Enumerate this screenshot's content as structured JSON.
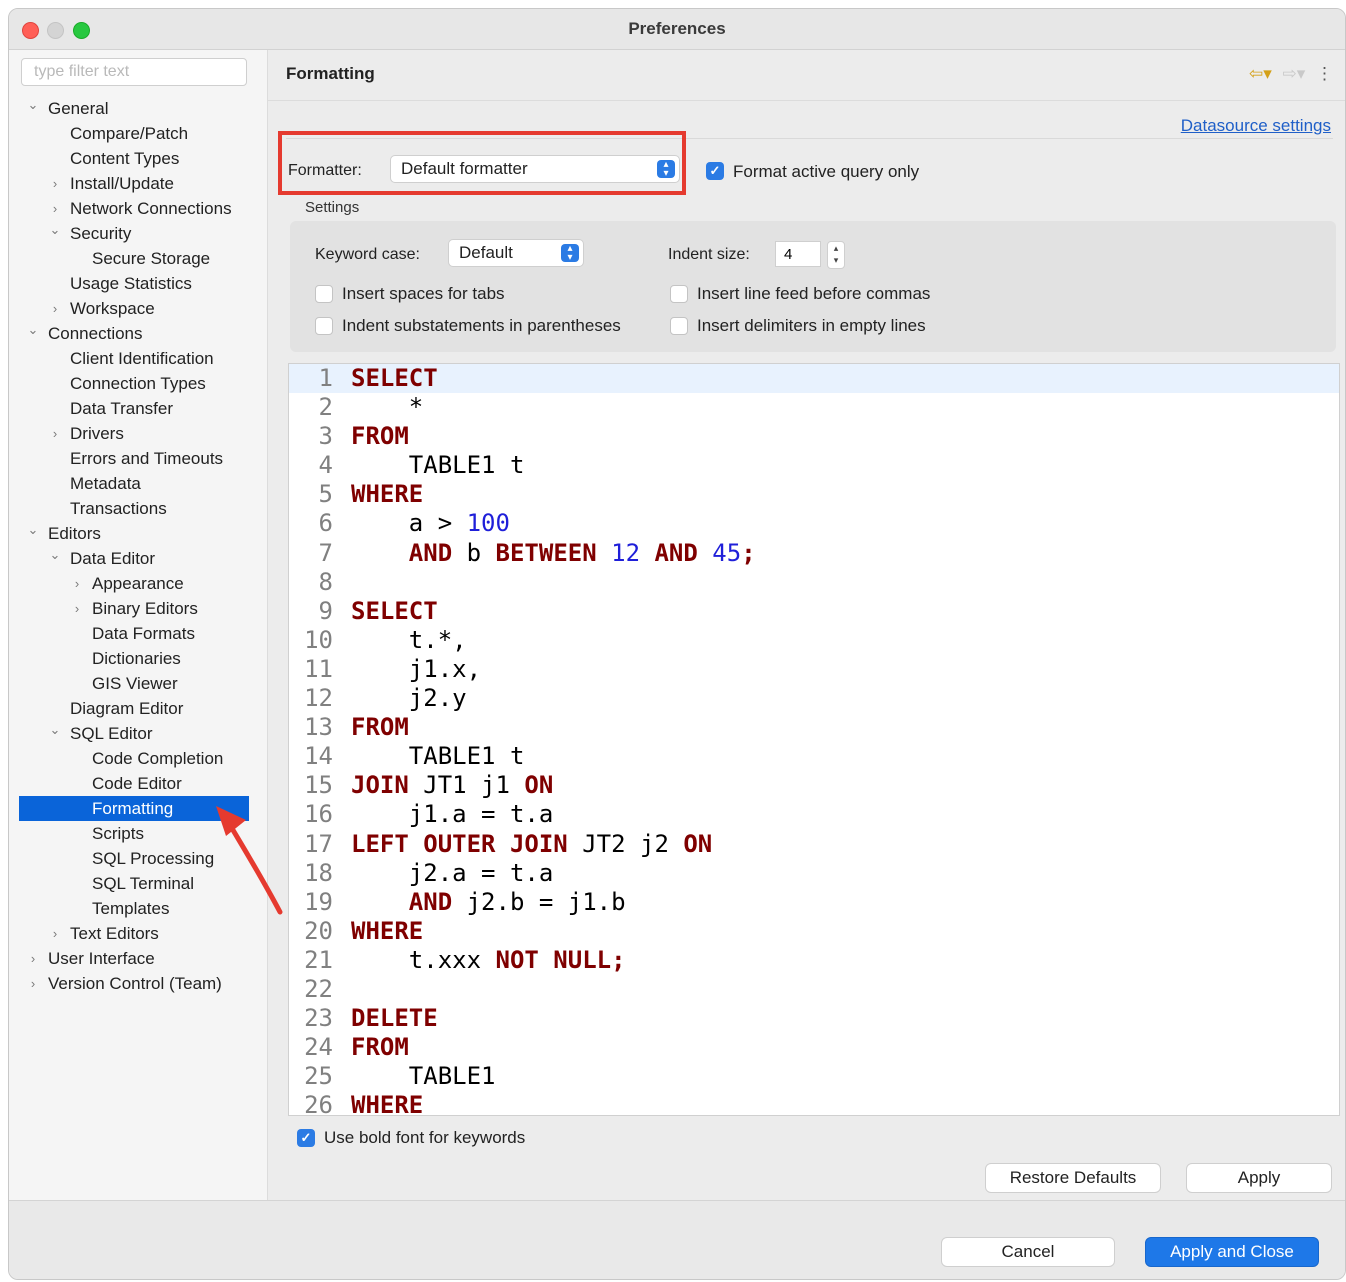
{
  "window": {
    "title": "Preferences"
  },
  "sidebar": {
    "filter_placeholder": "type filter text",
    "items": [
      {
        "label": "General",
        "indent": 0,
        "chev": "v"
      },
      {
        "label": "Compare/Patch",
        "indent": 1,
        "chev": ""
      },
      {
        "label": "Content Types",
        "indent": 1,
        "chev": ""
      },
      {
        "label": "Install/Update",
        "indent": 1,
        "chev": ">"
      },
      {
        "label": "Network Connections",
        "indent": 1,
        "chev": ">"
      },
      {
        "label": "Security",
        "indent": 1,
        "chev": "v"
      },
      {
        "label": "Secure Storage",
        "indent": 2,
        "chev": ""
      },
      {
        "label": "Usage Statistics",
        "indent": 1,
        "chev": ""
      },
      {
        "label": "Workspace",
        "indent": 1,
        "chev": ">"
      },
      {
        "label": "Connections",
        "indent": 0,
        "chev": "v"
      },
      {
        "label": "Client Identification",
        "indent": 1,
        "chev": ""
      },
      {
        "label": "Connection Types",
        "indent": 1,
        "chev": ""
      },
      {
        "label": "Data Transfer",
        "indent": 1,
        "chev": ""
      },
      {
        "label": "Drivers",
        "indent": 1,
        "chev": ">"
      },
      {
        "label": "Errors and Timeouts",
        "indent": 1,
        "chev": ""
      },
      {
        "label": "Metadata",
        "indent": 1,
        "chev": ""
      },
      {
        "label": "Transactions",
        "indent": 1,
        "chev": ""
      },
      {
        "label": "Editors",
        "indent": 0,
        "chev": "v"
      },
      {
        "label": "Data Editor",
        "indent": 1,
        "chev": "v"
      },
      {
        "label": "Appearance",
        "indent": 2,
        "chev": ">"
      },
      {
        "label": "Binary Editors",
        "indent": 2,
        "chev": ">"
      },
      {
        "label": "Data Formats",
        "indent": 2,
        "chev": ""
      },
      {
        "label": "Dictionaries",
        "indent": 2,
        "chev": ""
      },
      {
        "label": "GIS Viewer",
        "indent": 2,
        "chev": ""
      },
      {
        "label": "Diagram Editor",
        "indent": 1,
        "chev": ""
      },
      {
        "label": "SQL Editor",
        "indent": 1,
        "chev": "v"
      },
      {
        "label": "Code Completion",
        "indent": 2,
        "chev": ""
      },
      {
        "label": "Code Editor",
        "indent": 2,
        "chev": ""
      },
      {
        "label": "Formatting",
        "indent": 2,
        "chev": "",
        "selected": true
      },
      {
        "label": "Scripts",
        "indent": 2,
        "chev": ""
      },
      {
        "label": "SQL Processing",
        "indent": 2,
        "chev": ""
      },
      {
        "label": "SQL Terminal",
        "indent": 2,
        "chev": ""
      },
      {
        "label": "Templates",
        "indent": 2,
        "chev": ""
      },
      {
        "label": "Text Editors",
        "indent": 1,
        "chev": ">"
      },
      {
        "label": "User Interface",
        "indent": 0,
        "chev": ">"
      },
      {
        "label": "Version Control (Team)",
        "indent": 0,
        "chev": ">"
      }
    ]
  },
  "main": {
    "title": "Formatting",
    "datasource_link": "Datasource settings",
    "formatter_label": "Formatter:",
    "formatter_value": "Default formatter",
    "format_active_query_only": "Format active query only",
    "settings_title": "Settings",
    "keyword_case_label": "Keyword case:",
    "keyword_case_value": "Default",
    "indent_size_label": "Indent size:",
    "indent_size_value": "4",
    "insert_spaces_for_tabs": "Insert spaces for tabs",
    "insert_line_feed_before_commas": "Insert line feed before commas",
    "indent_substatements": "Indent substatements in parentheses",
    "insert_delimiters_empty_lines": "Insert delimiters in empty lines",
    "use_bold_font": "Use bold font for keywords",
    "restore_defaults": "Restore Defaults",
    "apply": "Apply"
  },
  "footer": {
    "cancel": "Cancel",
    "apply_and_close": "Apply and Close"
  },
  "icons": {
    "back": "back-arrow-icon",
    "forward": "forward-arrow-icon",
    "menu": "view-menu-icon"
  },
  "colors": {
    "keyword": "#7f0000",
    "number": "#1f1fd9",
    "selection": "#0a64d9",
    "highlight": "#e53a2f"
  },
  "code_lines": [
    {
      "n": "1",
      "t": [
        {
          "k": "SELECT"
        }
      ]
    },
    {
      "n": "2",
      "t": [
        {
          "p": "    *"
        }
      ]
    },
    {
      "n": "3",
      "t": [
        {
          "k": "FROM"
        }
      ]
    },
    {
      "n": "4",
      "t": [
        {
          "p": "    TABLE1 t"
        }
      ]
    },
    {
      "n": "5",
      "t": [
        {
          "k": "WHERE"
        }
      ]
    },
    {
      "n": "6",
      "t": [
        {
          "p": "    a > "
        },
        {
          "d": "100"
        }
      ]
    },
    {
      "n": "7",
      "t": [
        {
          "p": "    "
        },
        {
          "k": "AND"
        },
        {
          "p": " b "
        },
        {
          "k": "BETWEEN"
        },
        {
          "p": " "
        },
        {
          "d": "12"
        },
        {
          "p": " "
        },
        {
          "k": "AND"
        },
        {
          "p": " "
        },
        {
          "d": "45"
        },
        {
          "k": ";"
        }
      ]
    },
    {
      "n": "8",
      "t": [
        {
          "p": ""
        }
      ]
    },
    {
      "n": "9",
      "t": [
        {
          "k": "SELECT"
        }
      ]
    },
    {
      "n": "10",
      "t": [
        {
          "p": "    t.*,"
        }
      ]
    },
    {
      "n": "11",
      "t": [
        {
          "p": "    j1.x,"
        }
      ]
    },
    {
      "n": "12",
      "t": [
        {
          "p": "    j2.y"
        }
      ]
    },
    {
      "n": "13",
      "t": [
        {
          "k": "FROM"
        }
      ]
    },
    {
      "n": "14",
      "t": [
        {
          "p": "    TABLE1 t"
        }
      ]
    },
    {
      "n": "15",
      "t": [
        {
          "k": "JOIN"
        },
        {
          "p": " JT1 j1 "
        },
        {
          "k": "ON"
        }
      ]
    },
    {
      "n": "16",
      "t": [
        {
          "p": "    j1.a = t.a"
        }
      ]
    },
    {
      "n": "17",
      "t": [
        {
          "k": "LEFT OUTER JOIN"
        },
        {
          "p": " JT2 j2 "
        },
        {
          "k": "ON"
        }
      ]
    },
    {
      "n": "18",
      "t": [
        {
          "p": "    j2.a = t.a"
        }
      ]
    },
    {
      "n": "19",
      "t": [
        {
          "p": "    "
        },
        {
          "k": "AND"
        },
        {
          "p": " j2.b = j1.b"
        }
      ]
    },
    {
      "n": "20",
      "t": [
        {
          "k": "WHERE"
        }
      ]
    },
    {
      "n": "21",
      "t": [
        {
          "p": "    t.xxx "
        },
        {
          "k": "NOT NULL;"
        }
      ]
    },
    {
      "n": "22",
      "t": [
        {
          "p": ""
        }
      ]
    },
    {
      "n": "23",
      "t": [
        {
          "k": "DELETE"
        }
      ]
    },
    {
      "n": "24",
      "t": [
        {
          "k": "FROM"
        }
      ]
    },
    {
      "n": "25",
      "t": [
        {
          "p": "    TABLE1"
        }
      ]
    },
    {
      "n": "26",
      "t": [
        {
          "k": "WHERE"
        }
      ]
    }
  ]
}
